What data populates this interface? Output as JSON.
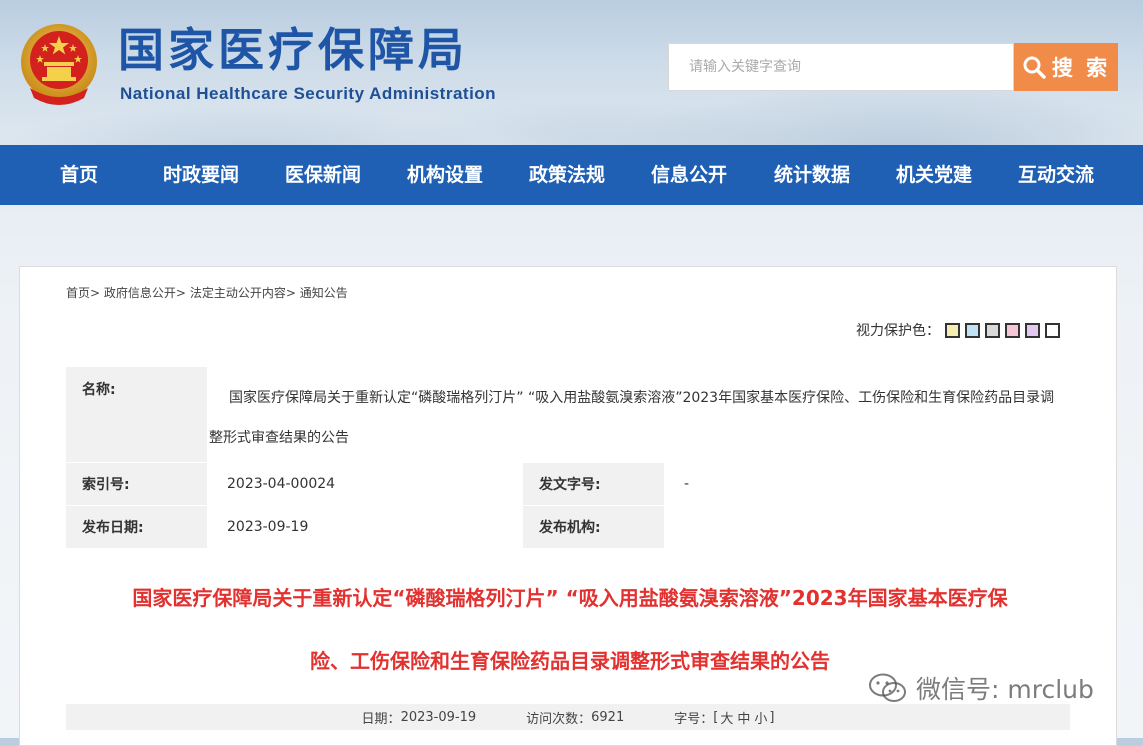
{
  "header": {
    "title": "国家医疗保障局",
    "subtitle": "National Healthcare Security Administration",
    "search_placeholder": "请输入关键字查询",
    "search_button": "搜 索"
  },
  "nav": {
    "items": [
      "首页",
      "时政要闻",
      "医保新闻",
      "机构设置",
      "政策法规",
      "信息公开",
      "统计数据",
      "机关党建",
      "互动交流"
    ]
  },
  "breadcrumb": {
    "items": [
      "首页",
      "政府信息公开",
      "法定主动公开内容",
      "通知公告"
    ],
    "separator": ">"
  },
  "eye_care": {
    "label": "视力保护色：",
    "colors": [
      "#f5eeb0",
      "#bfe3f5",
      "#d9d9d9",
      "#f5c6d7",
      "#e3c9f2",
      "#ffffff"
    ]
  },
  "info": {
    "name_label": "名称:",
    "name_value": "国家医疗保障局关于重新认定“磷酸瑞格列汀片” “吸入用盐酸氨溴索溶液”2023年国家基本医疗保险、工伤保险和生育保险药品目录调整形式审查结果的公告",
    "index_label": "索引号:",
    "index_value": "2023-04-00024",
    "docno_label": "发文字号:",
    "docno_value": "-",
    "date_label": "发布日期:",
    "date_value": "2023-09-19",
    "org_label": "发布机构:",
    "org_value": ""
  },
  "article": {
    "title_line1": "国家医疗保障局关于重新认定“磷酸瑞格列汀片” “吸入用盐酸氨溴索溶液”2023年国家基本医疗保",
    "title_line2": "险、工伤保险和生育保险药品目录调整形式审查结果的公告",
    "date_label": "日期：",
    "date": "2023-09-19",
    "visits_label": "访问次数：",
    "visits": "6921",
    "font_label": "字号：",
    "font_sizes": [
      "大",
      "中",
      "小"
    ]
  },
  "watermark": {
    "text": "微信号: mrclub"
  },
  "colors": {
    "brand_blue": "#1f60b4",
    "search_orange": "#f08b4a",
    "title_red": "#e2312f"
  }
}
